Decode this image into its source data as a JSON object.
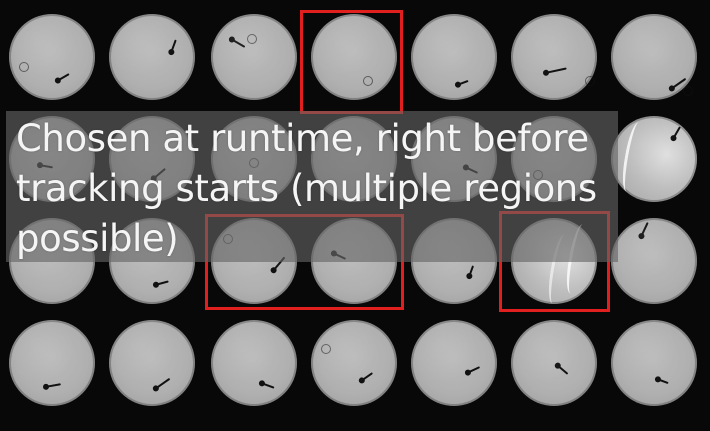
{
  "image": {
    "caption": "Chosen at runtime, right before tracking starts (multiple regions possible)",
    "grid": {
      "rows": 4,
      "columns": 7
    },
    "colors": {
      "background": "#080808",
      "well": "#b7b7b7",
      "highlight_box": "#e21f1f",
      "caption_panel": "#646464",
      "caption_text": "#f5f5f5"
    }
  }
}
